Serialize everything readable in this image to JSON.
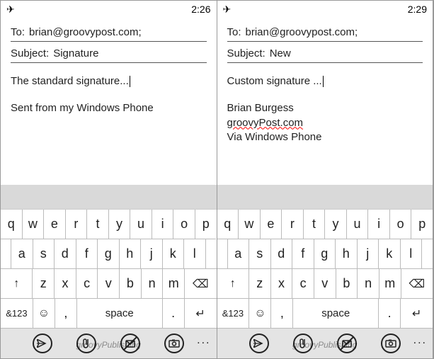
{
  "left": {
    "status": {
      "airplane": "✈",
      "time": "2:26"
    },
    "fields": {
      "to_label": "To:",
      "to_value": "brian@groovypost.com;",
      "subject_label": "Subject:",
      "subject_value": "Signature"
    },
    "body": {
      "typing": "The standard signature...",
      "signature_lines": [
        "Sent from my Windows Phone"
      ]
    }
  },
  "right": {
    "status": {
      "airplane": "✈",
      "time": "2:29"
    },
    "fields": {
      "to_label": "To:",
      "to_value": "brian@groovypost.com;",
      "subject_label": "Subject:",
      "subject_value": "New"
    },
    "body": {
      "typing": "Custom signature ...",
      "signature_lines": [
        "Brian Burgess",
        "groovyPost.com",
        "Via Windows Phone"
      ]
    }
  },
  "keyboard": {
    "row1": [
      "q",
      "w",
      "e",
      "r",
      "t",
      "y",
      "u",
      "i",
      "o",
      "p"
    ],
    "row2": [
      "a",
      "s",
      "d",
      "f",
      "g",
      "h",
      "j",
      "k",
      "l"
    ],
    "row3": {
      "shift": "↑",
      "keys": [
        "z",
        "x",
        "c",
        "v",
        "b",
        "n",
        "m"
      ],
      "backspace": "⌫"
    },
    "row4": {
      "sym": "&123",
      "emoji": "☺",
      "comma": ",",
      "space": "space",
      "period": ".",
      "enter": "↵"
    }
  },
  "appbar": {
    "send": "send",
    "attach": "attach",
    "close": "close",
    "picture": "picture",
    "more": "..."
  },
  "watermark": "groovyPublishing"
}
